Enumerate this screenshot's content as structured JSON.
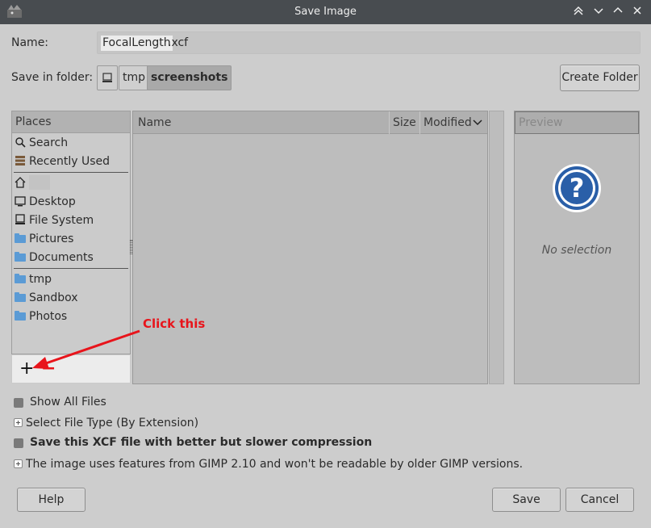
{
  "titlebar": {
    "title": "Save Image",
    "icons": [
      "gimp-app-icon",
      "keep-above-icon",
      "minimize-icon",
      "maximize-icon",
      "close-icon"
    ]
  },
  "name": {
    "label": "Name:",
    "selected_text": "FocalLength",
    "rest_text": ".xcf"
  },
  "folder": {
    "label": "Save in folder:",
    "crumbs": [
      "tmp",
      "screenshots"
    ],
    "create_folder": "Create Folder"
  },
  "places": {
    "header": "Places",
    "items": [
      "Search",
      "Recently Used",
      "Desktop",
      "File System",
      "Pictures",
      "Documents",
      "tmp",
      "Sandbox",
      "Photos"
    ],
    "add": "+",
    "remove": "−"
  },
  "files": {
    "columns": [
      "Name",
      "Size",
      "Modified"
    ]
  },
  "preview": {
    "header": "Preview",
    "no_selection": "No selection"
  },
  "options": {
    "show_all_files": "Show All Files",
    "select_file_type": "Select File Type (By Extension)",
    "compression": "Save this XCF file with better but slower compression",
    "compat": "The image uses features from GIMP 2.10 and won't be readable by older GIMP versions."
  },
  "buttons": {
    "help": "Help",
    "save": "Save",
    "cancel": "Cancel"
  },
  "annotation": {
    "text": "Click this",
    "color": "#e8141b"
  },
  "colors": {
    "titlebar": "#484c50",
    "window": "#cdcdcd",
    "folder": "#5b9bd5",
    "help_icon": "#2a5fa8"
  }
}
